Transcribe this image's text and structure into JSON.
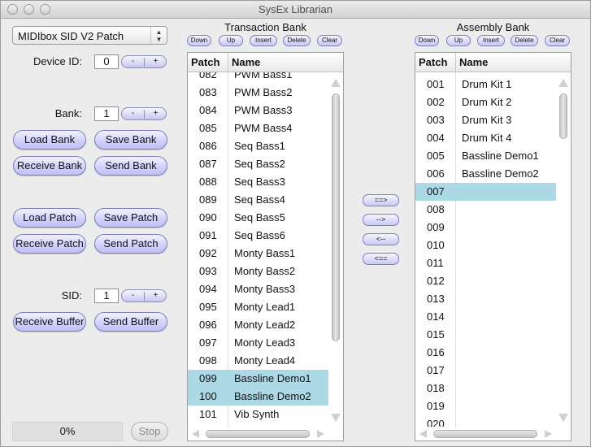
{
  "window": {
    "title": "SysEx Librarian"
  },
  "left": {
    "popup_value": "MIDIbox SID V2 Patch",
    "device_id": {
      "label": "Device ID:",
      "value": "0"
    },
    "bank": {
      "label": "Bank:",
      "value": "1"
    },
    "sid": {
      "label": "SID:",
      "value": "1"
    },
    "stepper": {
      "minus": "-",
      "plus": "+"
    },
    "buttons": {
      "load_bank": "Load Bank",
      "save_bank": "Save Bank",
      "receive_bank": "Receive Bank",
      "send_bank": "Send Bank",
      "load_patch": "Load Patch",
      "save_patch": "Save Patch",
      "receive_patch": "Receive Patch",
      "send_patch": "Send Patch",
      "receive_buffer": "Receive Buffer",
      "send_buffer": "Send Buffer"
    },
    "progress": "0%",
    "stop": "Stop"
  },
  "bank_buttons": {
    "down": "Down",
    "up": "Up",
    "insert": "Insert",
    "delete": "Delete",
    "clear": "Clear"
  },
  "transaction": {
    "title": "Transaction Bank",
    "col_patch": "Patch",
    "col_name": "Name",
    "top_partial": {
      "patch": "082",
      "name": "PWM Bass1"
    },
    "rows": [
      {
        "patch": "083",
        "name": "PWM Bass2"
      },
      {
        "patch": "084",
        "name": "PWM Bass3"
      },
      {
        "patch": "085",
        "name": "PWM Bass4"
      },
      {
        "patch": "086",
        "name": "Seq Bass1"
      },
      {
        "patch": "087",
        "name": "Seq Bass2"
      },
      {
        "patch": "088",
        "name": "Seq Bass3"
      },
      {
        "patch": "089",
        "name": "Seq Bass4"
      },
      {
        "patch": "090",
        "name": "Seq Bass5"
      },
      {
        "patch": "091",
        "name": "Seq Bass6"
      },
      {
        "patch": "092",
        "name": "Monty Bass1"
      },
      {
        "patch": "093",
        "name": "Monty Bass2"
      },
      {
        "patch": "094",
        "name": "Monty Bass3"
      },
      {
        "patch": "095",
        "name": "Monty Lead1"
      },
      {
        "patch": "096",
        "name": "Monty Lead2"
      },
      {
        "patch": "097",
        "name": "Monty Lead3"
      },
      {
        "patch": "098",
        "name": "Monty Lead4"
      },
      {
        "patch": "099",
        "name": "Bassline Demo1",
        "selected": true
      },
      {
        "patch": "100",
        "name": "Bassline Demo2",
        "selected": true
      },
      {
        "patch": "101",
        "name": "Vib Synth"
      }
    ]
  },
  "transfer": {
    "copy_all_right": "==>",
    "copy_right": "-->",
    "copy_left": "<--",
    "copy_all_left": "<=="
  },
  "assembly": {
    "title": "Assembly Bank",
    "col_patch": "Patch",
    "col_name": "Name",
    "rows": [
      {
        "patch": "001",
        "name": "Drum Kit 1"
      },
      {
        "patch": "002",
        "name": "Drum Kit 2"
      },
      {
        "patch": "003",
        "name": "Drum Kit 3"
      },
      {
        "patch": "004",
        "name": "Drum Kit 4"
      },
      {
        "patch": "005",
        "name": "Bassline Demo1"
      },
      {
        "patch": "006",
        "name": "Bassline Demo2"
      },
      {
        "patch": "007",
        "name": "",
        "selected": true
      },
      {
        "patch": "008",
        "name": ""
      },
      {
        "patch": "009",
        "name": ""
      },
      {
        "patch": "010",
        "name": ""
      },
      {
        "patch": "011",
        "name": ""
      },
      {
        "patch": "012",
        "name": ""
      },
      {
        "patch": "013",
        "name": ""
      },
      {
        "patch": "014",
        "name": ""
      },
      {
        "patch": "015",
        "name": ""
      },
      {
        "patch": "016",
        "name": ""
      },
      {
        "patch": "017",
        "name": ""
      },
      {
        "patch": "018",
        "name": ""
      },
      {
        "patch": "019",
        "name": ""
      },
      {
        "patch": "020",
        "name": ""
      }
    ]
  },
  "colors": {
    "selection": "#add8e6",
    "button_fill": "#d2d2fb",
    "button_border": "#7e7ec0"
  }
}
